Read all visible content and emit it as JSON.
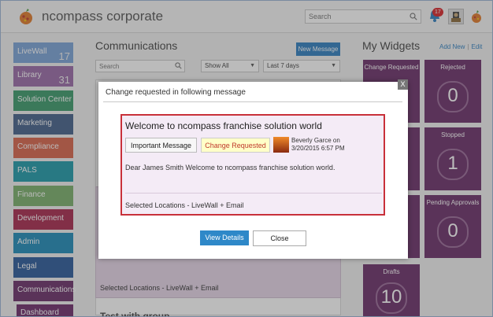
{
  "header": {
    "brand": "ncompass corporate",
    "search_placeholder": "Search",
    "notification_count": "17"
  },
  "sidebar": {
    "items": [
      {
        "label": "LiveWall",
        "count": "17",
        "color": "#7aa3d8"
      },
      {
        "label": "Library",
        "count": "31",
        "color": "#9a6aa8"
      },
      {
        "label": "Solution Center",
        "count": "",
        "color": "#3b9a6a"
      },
      {
        "label": "Marketing",
        "count": "",
        "color": "#44628a"
      },
      {
        "label": "Compliance",
        "count": "",
        "color": "#d9644a"
      },
      {
        "label": "PALS",
        "count": "",
        "color": "#1e9aaa"
      },
      {
        "label": "Finance",
        "count": "",
        "color": "#7ab06a"
      },
      {
        "label": "Development",
        "count": "",
        "color": "#a8284e"
      },
      {
        "label": "Admin",
        "count": "",
        "color": "#1e8ab8"
      },
      {
        "label": "Legal",
        "count": "",
        "color": "#2a5a9a"
      },
      {
        "label": "Communications",
        "count": "",
        "color": "#6b2f69"
      }
    ],
    "sub_item": "Dashboard"
  },
  "communications": {
    "title": "Communications",
    "new_message_label": "New Message",
    "search_placeholder": "Search",
    "filter_show": "Show All",
    "filter_days": "Last 7 days",
    "bg_locations": "Selected Locations - LiveWall + Email",
    "bg_next_title": "Test with group"
  },
  "widgets": {
    "title": "My Widgets",
    "add_new": "Add New",
    "edit": "Edit",
    "tiles": [
      {
        "label": "Change Requested",
        "value": ""
      },
      {
        "label": "Rejected",
        "value": "0"
      },
      {
        "label": "",
        "value": ""
      },
      {
        "label": "Stopped",
        "value": "1"
      },
      {
        "label": "",
        "value": ""
      },
      {
        "label": "Pending Approvals",
        "value": "0"
      },
      {
        "label": "Drafts",
        "value": "10"
      }
    ]
  },
  "modal": {
    "close_glyph": "X",
    "title": "Change requested in following message",
    "message_title": "Welcome to ncompass franchise solution world",
    "important_label": "Important Message",
    "change_requested_label": "Change Requested",
    "author_name": "Beverly Garce on",
    "author_date": "3/20/2015 6:57 PM",
    "body": "Dear James Smith Welcome to ncompass franchise solution world.",
    "locations": "Selected Locations - LiveWall + Email",
    "view_details_label": "View Details",
    "close_label": "Close"
  }
}
